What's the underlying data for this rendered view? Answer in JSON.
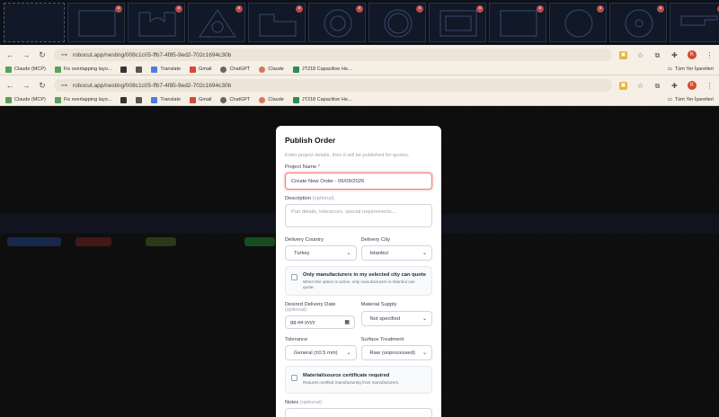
{
  "browser": {
    "url": "robocut.app/nesting/008c1c05-ffb7-4f85-9ed2-702c1694c30b",
    "profile_initial": "K",
    "bookmarks": [
      {
        "label": "Claude (MCP)",
        "color": "#5aa05a"
      },
      {
        "label": "Fix overlapping layo...",
        "color": "#5aa05a"
      },
      {
        "label": "",
        "color": "#444444"
      },
      {
        "label": "",
        "color": "#444444"
      },
      {
        "label": "Translate",
        "color": "#4a7fe0"
      },
      {
        "label": "Gmail",
        "color": "#d64a3a"
      },
      {
        "label": "ChatGPT",
        "color": "#666666"
      },
      {
        "label": "Claude",
        "color": "#d9775b"
      },
      {
        "label": "JT218 Capacitive He...",
        "color": "#2e8b57"
      }
    ],
    "all_bookmarks_label": "Tüm Yer İşaretleri"
  },
  "modal": {
    "title": "Publish Order",
    "subtitle": "Enter project details, then it will be published for quotes.",
    "project_name_label": "Project Name",
    "project_name_required": "*",
    "project_name_value": "Create New Order - 06/09/2026",
    "description_label": "Description",
    "description_optional": "(optional)",
    "description_placeholder": "Part details, tolerances, special requirements...",
    "delivery_country_label": "Delivery Country",
    "delivery_country_value": "Turkey",
    "delivery_city_label": "Delivery City",
    "delivery_city_value": "Istanbul",
    "city_only_title": "Only manufacturers in my selected city can quote",
    "city_only_desc": "When this option is active, only manufacturers in Istanbul can quote.",
    "desired_delivery_label": "Desired Delivery Date",
    "desired_delivery_optional": "(optional)",
    "date_placeholder": "gg.aa.yyyy",
    "material_supply_label": "Material Supply",
    "material_supply_value": "Not specified",
    "tolerance_label": "Tolerance",
    "tolerance_value": "General (±0.5 mm)",
    "surface_label": "Surface Treatment",
    "surface_value": "Raw (unprocessed)",
    "cert_title": "Material/source certificate required",
    "cert_desc": "Request certified manufacturing from manufacturers.",
    "notes_label": "Notes",
    "notes_optional": "(optional)"
  },
  "colors": {
    "focus_border": "#ef7f7f",
    "nest_bg": "#0d1018",
    "chrome_bg": "#f5efe6"
  }
}
